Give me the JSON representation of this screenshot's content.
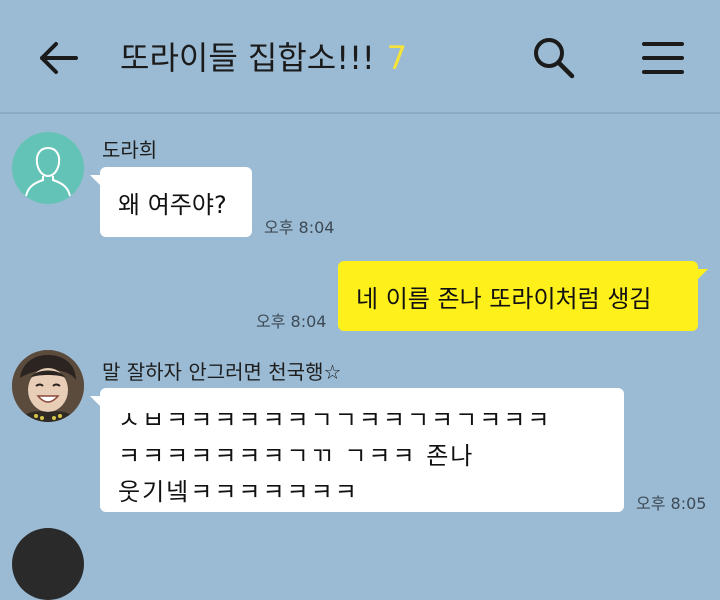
{
  "header": {
    "title": "또라이들 집합소!!!",
    "member_count": "7",
    "back_icon": "back-arrow-icon",
    "search_icon": "search-icon",
    "menu_icon": "hamburger-menu-icon",
    "count_color": "#f5e33a"
  },
  "messages": [
    {
      "sender": "도라희",
      "text": "왜 여주야?",
      "time": "오후 8:04",
      "side": "left"
    },
    {
      "sender": "",
      "text": "네 이름 존나 또라이처럼 생김",
      "time": "오후 8:04",
      "side": "right"
    },
    {
      "sender": "말 잘하자 안그러면 천국행☆",
      "lines": [
        "ㅅㅂㅋㅋㅋㅋㅋㅋㄱㄱㅋㅋㄱㅋㄱㅋㅋㅋ",
        "ㅋㅋㅋㅋㅋㅋㅋㄱㄲ ㄱㅋㅋ 존나",
        "웃기넼ㅋㅋㅋㅋㅋㅋㅋ"
      ],
      "time": "오후 8:05",
      "side": "left"
    }
  ],
  "colors": {
    "background": "#9bbbd4",
    "my_bubble": "#fef01b",
    "their_bubble": "#ffffff"
  }
}
